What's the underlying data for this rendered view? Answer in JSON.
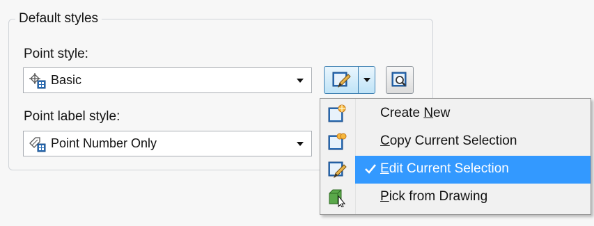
{
  "group": {
    "title": "Default styles"
  },
  "point_style": {
    "label": "Point style:",
    "value": "Basic",
    "icon": "point-style-icon"
  },
  "point_label_style": {
    "label": "Point label style:",
    "value": "Point Number Only",
    "icon": "label-style-icon"
  },
  "buttons": {
    "edit_split_icon": "edit-style-icon",
    "view_icon": "magnifier-icon"
  },
  "menu": {
    "items": [
      {
        "pre": "Create ",
        "ul": "N",
        "post": "ew",
        "icon": "create-new-icon",
        "checked": false
      },
      {
        "pre": "",
        "ul": "C",
        "post": "opy Current Selection",
        "icon": "copy-selection-icon",
        "checked": false
      },
      {
        "pre": "",
        "ul": "E",
        "post": "dit Current Selection",
        "icon": "edit-selection-icon",
        "checked": true
      },
      {
        "pre": "",
        "ul": "P",
        "post": "ick from Drawing",
        "icon": "pick-from-drawing-icon",
        "checked": false
      }
    ]
  },
  "colors": {
    "highlight": "#3399ff",
    "button_border": "#3c7fb1"
  }
}
